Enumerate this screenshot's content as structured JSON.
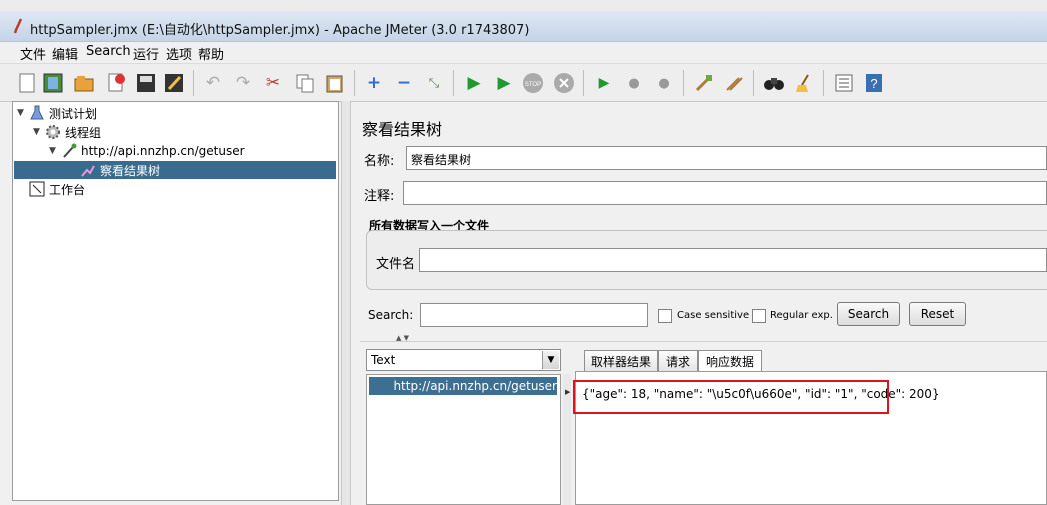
{
  "window": {
    "title": "httpSampler.jmx (E:\\自动化\\httpSampler.jmx) - Apache JMeter (3.0 r1743807)"
  },
  "menu": [
    "文件",
    "编辑",
    "Search",
    "运行",
    "选项",
    "帮助"
  ],
  "tree": {
    "plan": "测试计划",
    "thread_group": "线程组",
    "sampler": "http://api.nnzhp.cn/getuser",
    "listener": "察看结果树",
    "workbench": "工作台"
  },
  "panel": {
    "title": "察看结果树",
    "name_label": "名称:",
    "name_value": "察看结果树",
    "comment_label": "注释:",
    "comment_value": "",
    "group_title": "所有数据写入一个文件",
    "file_label": "文件名",
    "file_value": ""
  },
  "search": {
    "label": "Search:",
    "value": "",
    "case_label": "Case sensitive",
    "regex_label": "Regular exp.",
    "search_button": "Search",
    "reset_button": "Reset"
  },
  "results": {
    "renderer": "Text",
    "items": [
      "http://api.nnzhp.cn/getuser"
    ],
    "tabs": [
      "取样器结果",
      "请求",
      "响应数据"
    ],
    "response_text": "{\"age\": 18, \"name\": \"\\u5c0f\\u660e\", \"id\": \"1\", \"code\": 200}"
  },
  "colors": {
    "selection": "#386b8d",
    "highlight_box": "#d9161b"
  }
}
